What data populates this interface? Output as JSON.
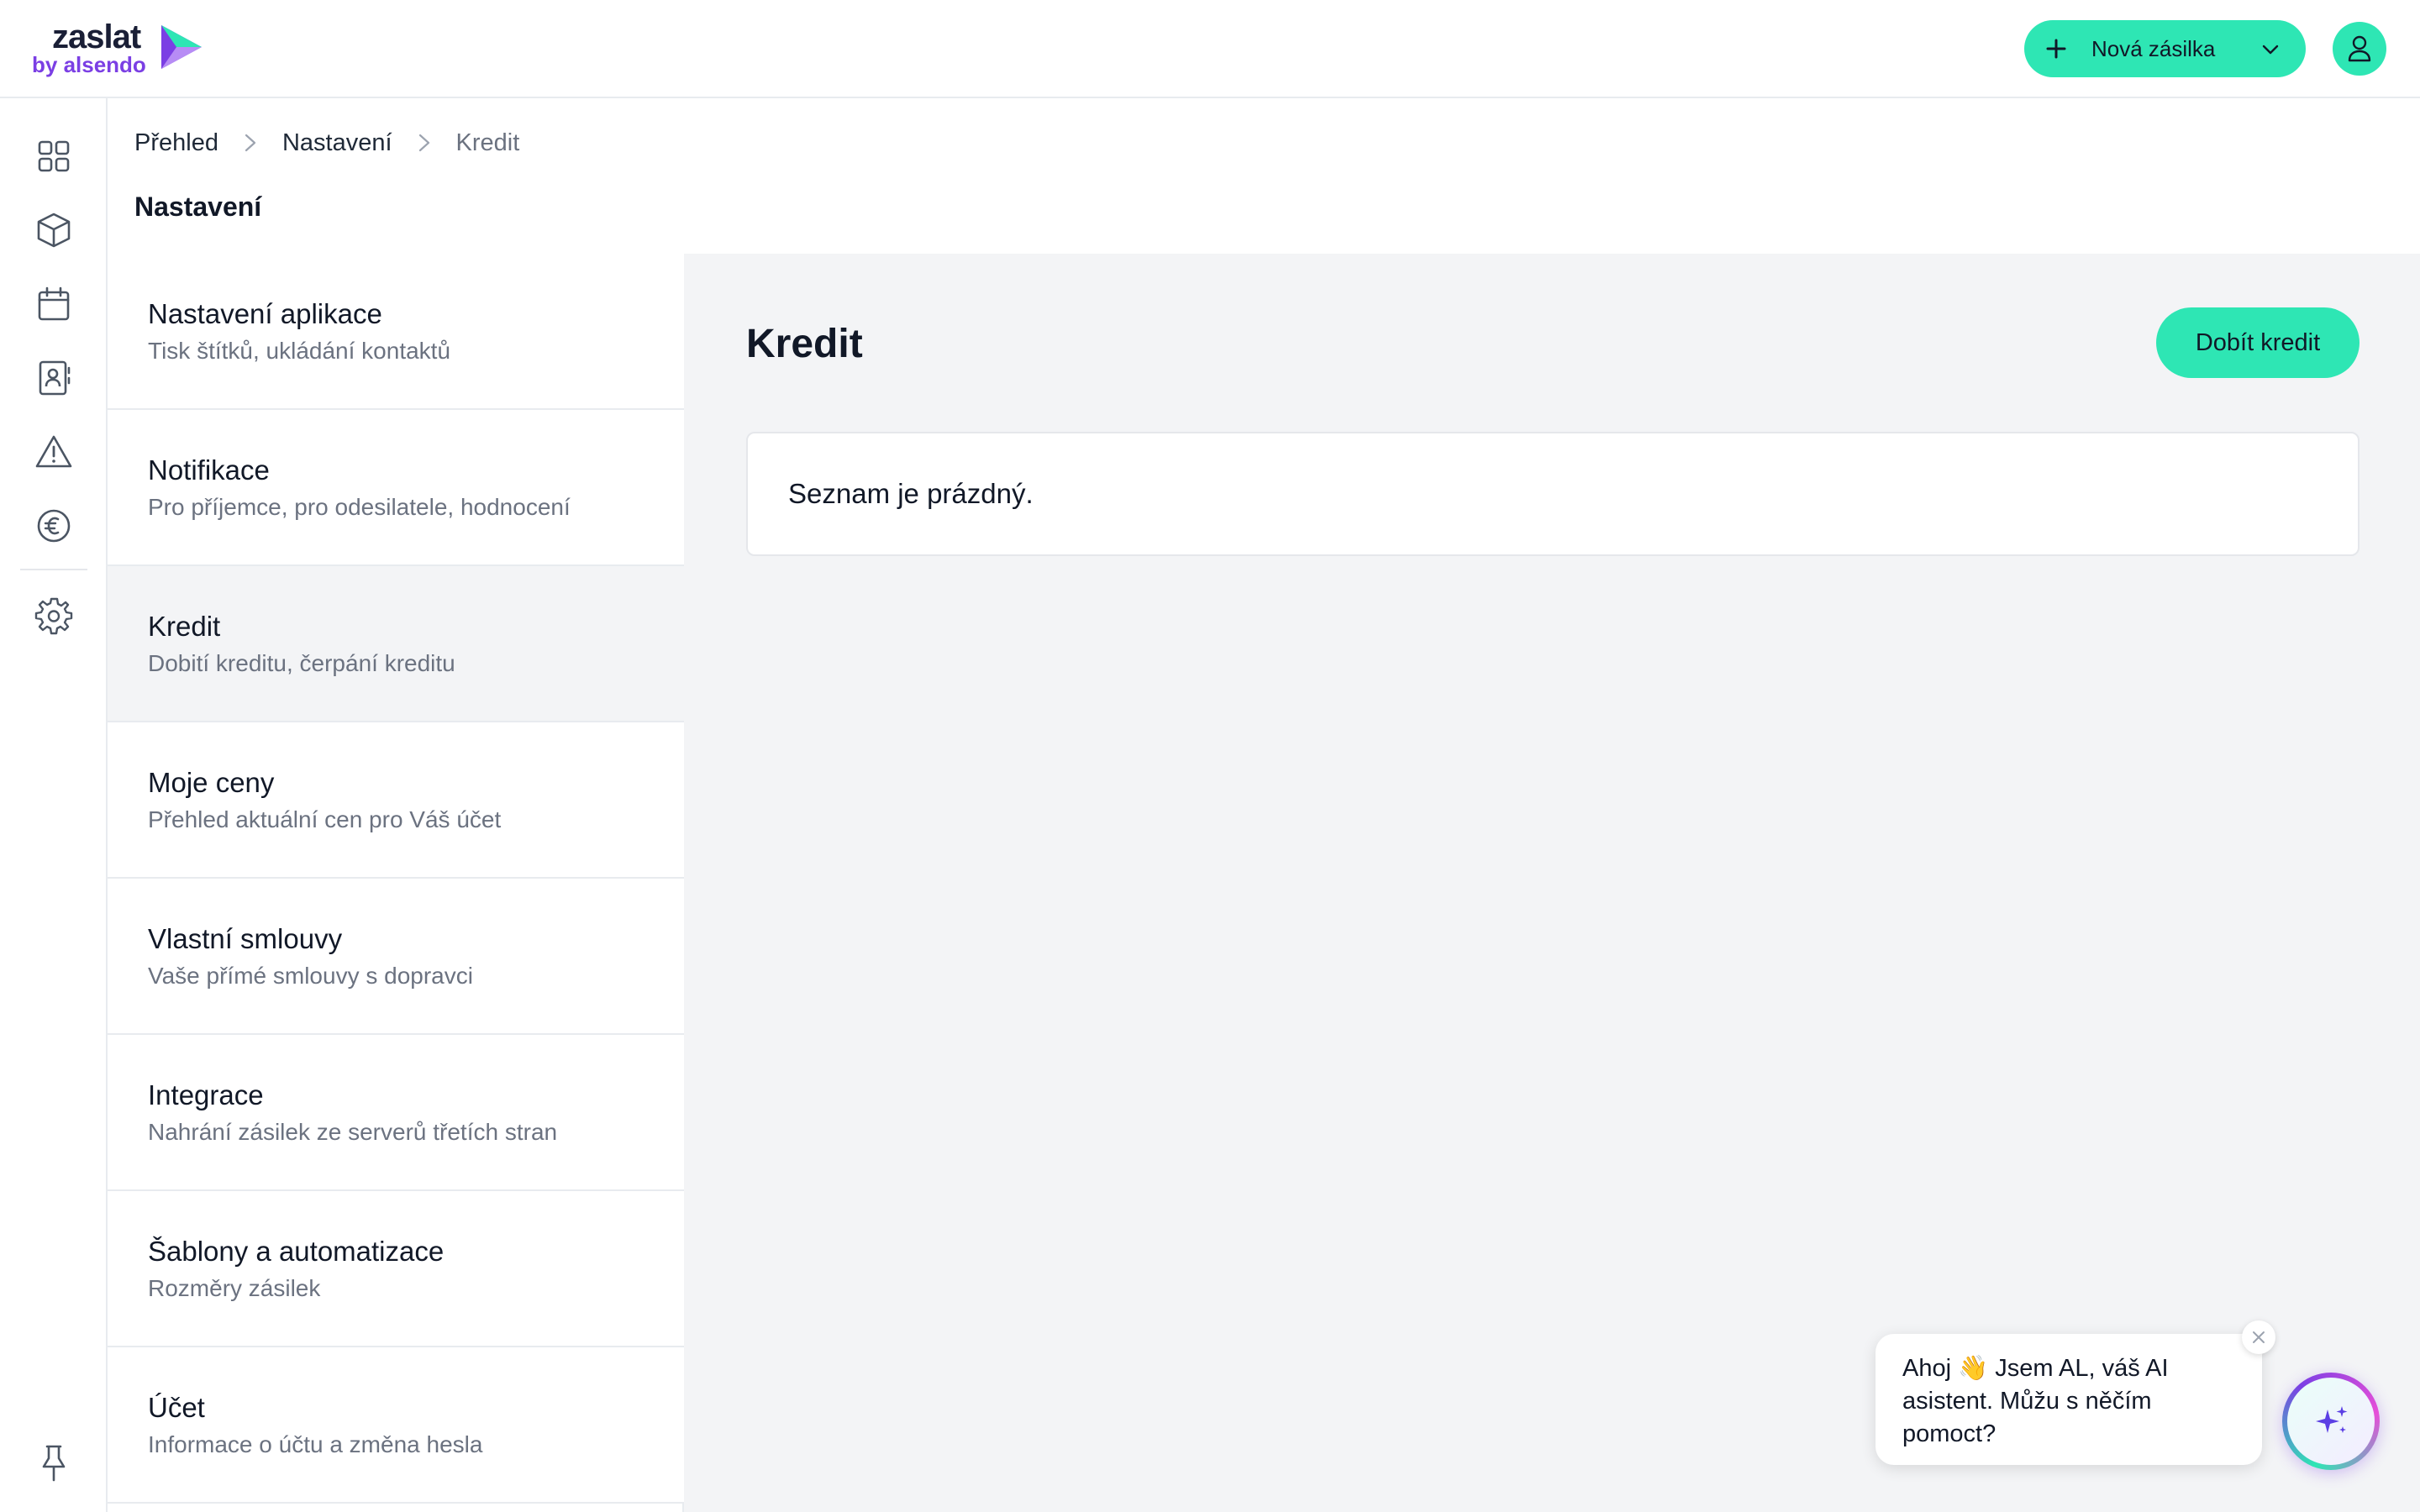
{
  "brand": {
    "name": "zaslat",
    "sub": "by alsendo",
    "accent": "#2ee6b4",
    "purple": "#7b3fe4"
  },
  "header": {
    "new_shipment_label": "Nová zásilka"
  },
  "sidebar": {
    "icons": [
      "dashboard-icon",
      "package-icon",
      "calendar-icon",
      "contacts-icon",
      "warning-icon",
      "euro-icon",
      "gear-icon",
      "pin-icon"
    ]
  },
  "breadcrumb": [
    "Přehled",
    "Nastavení",
    "Kredit"
  ],
  "page_title": "Nastavení",
  "settings_menu": [
    {
      "title": "Nastavení aplikace",
      "subtitle": "Tisk štítků, ukládání kontaktů"
    },
    {
      "title": "Notifikace",
      "subtitle": "Pro příjemce, pro odesilatele, hodnocení"
    },
    {
      "title": "Kredit",
      "subtitle": "Dobití kreditu, čerpání kreditu",
      "active": true
    },
    {
      "title": "Moje ceny",
      "subtitle": "Přehled aktuální cen pro Váš účet"
    },
    {
      "title": "Vlastní smlouvy",
      "subtitle": "Vaše přímé smlouvy s dopravci"
    },
    {
      "title": "Integrace",
      "subtitle": "Nahrání zásilek ze serverů třetích stran"
    },
    {
      "title": "Šablony a automatizace",
      "subtitle": "Rozměry zásilek"
    },
    {
      "title": "Účet",
      "subtitle": "Informace o účtu a změna hesla"
    }
  ],
  "content": {
    "title": "Kredit",
    "topup_label": "Dobít kredit",
    "empty_text": "Seznam je prázdný."
  },
  "assistant": {
    "message": "Ahoj 👋 Jsem AL, váš AI asistent. Můžu s něčím pomoct?"
  }
}
